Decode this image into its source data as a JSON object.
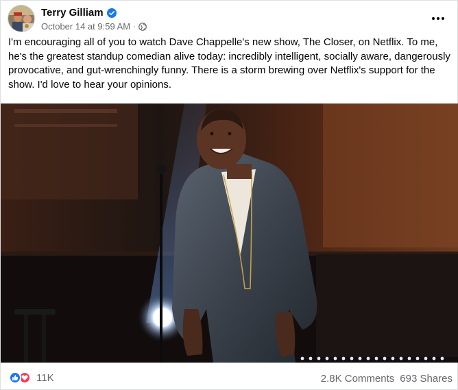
{
  "post": {
    "author": "Terry Gilliam",
    "verified_icon": "verified-badge-icon",
    "timestamp": "October 14 at 9:59 AM",
    "separator": "·",
    "audience_icon": "globe-icon",
    "more_icon": "more-options-icon",
    "caption": "I'm encouraging all of you to watch Dave Chappelle's new show, The Closer, on Netflix. To me, he's the greatest standup comedian alive today: incredibly intelligent, socially aware, dangerously provocative, and gut-wrenchingly funny. There is a storm brewing over Netflix's support for the show. I'd love to hear your opinions.",
    "photo": "comedian-on-stage-photo"
  },
  "engagement": {
    "reaction_icons": [
      "like-icon",
      "love-icon"
    ],
    "reactions_count": "11K",
    "comments": "2.8K Comments",
    "shares": "693 Shares"
  },
  "colors": {
    "brand_blue": "#1877f2",
    "love_red": "#f33e58",
    "secondary_text": "#65676b"
  }
}
